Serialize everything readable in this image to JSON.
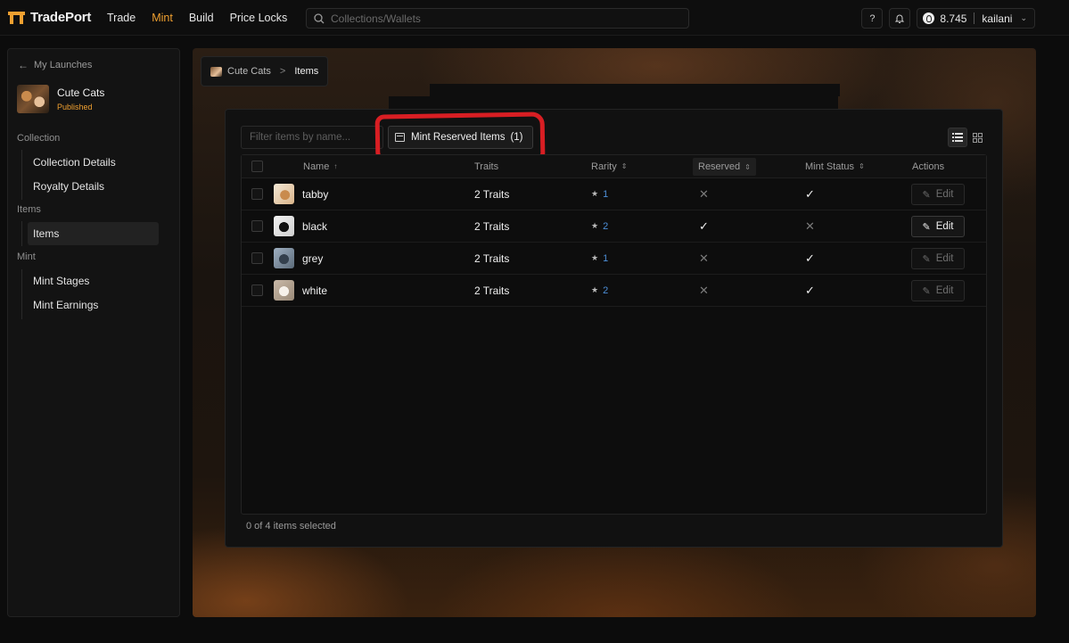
{
  "topbar": {
    "brand": "TradePort",
    "nav": [
      {
        "label": "Trade",
        "active": false
      },
      {
        "label": "Mint",
        "active": true
      },
      {
        "label": "Build",
        "active": false
      },
      {
        "label": "Price Locks",
        "active": false
      }
    ],
    "search_placeholder": "Collections/Wallets",
    "help_label": "?",
    "balance": "8.745",
    "username": "kailani",
    "accent": "#f0a030"
  },
  "sidebar": {
    "back_label": "My Launches",
    "collection_name": "Cute Cats",
    "collection_status": "Published",
    "sections": {
      "collection": "Collection",
      "items": "Items",
      "mint": "Mint"
    },
    "items": {
      "collection_details": "Collection Details",
      "royalty_details": "Royalty Details",
      "items": "Items",
      "mint_stages": "Mint Stages",
      "mint_earnings": "Mint Earnings"
    }
  },
  "breadcrumb": {
    "parent": "Cute Cats",
    "separator": ">",
    "current": "Items"
  },
  "toolbar": {
    "filter_placeholder": "Filter items by name...",
    "mint_reserved_label": "Mint Reserved Items",
    "mint_reserved_count": "(1)",
    "annotation_color": "#d81e23"
  },
  "table": {
    "headers": {
      "name": "Name",
      "traits": "Traits",
      "rarity": "Rarity",
      "reserved": "Reserved",
      "mint_status": "Mint Status",
      "actions": "Actions"
    },
    "edit_label": "Edit",
    "rows": [
      {
        "name": "tabby",
        "traits": "2 Traits",
        "rarity": "1",
        "reserved": false,
        "minted": true,
        "edit_enabled": false
      },
      {
        "name": "black",
        "traits": "2 Traits",
        "rarity": "2",
        "reserved": true,
        "minted": false,
        "edit_enabled": true
      },
      {
        "name": "grey",
        "traits": "2 Traits",
        "rarity": "1",
        "reserved": false,
        "minted": true,
        "edit_enabled": false
      },
      {
        "name": "white",
        "traits": "2 Traits",
        "rarity": "2",
        "reserved": false,
        "minted": true,
        "edit_enabled": false
      }
    ],
    "selected_text": "0 of 4 items selected"
  }
}
